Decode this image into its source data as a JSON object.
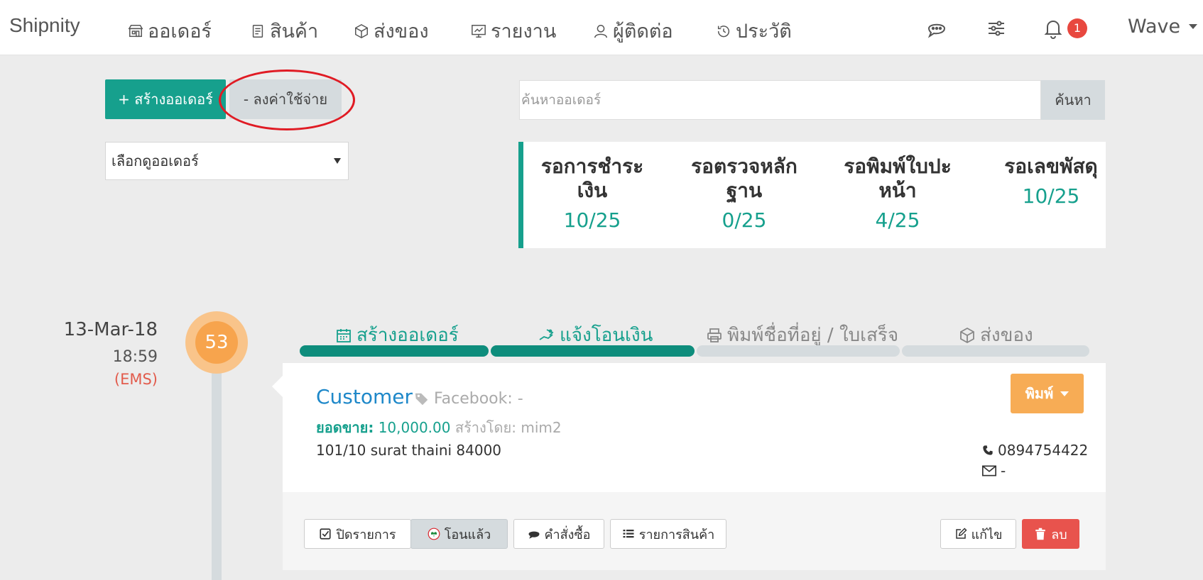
{
  "nav": {
    "brand": "Shipnity",
    "items": [
      {
        "label": "ออเดอร์",
        "icon": "store-icon"
      },
      {
        "label": "สินค้า",
        "icon": "product-icon"
      },
      {
        "label": "ส่งของ",
        "icon": "box-icon"
      },
      {
        "label": "รายงาน",
        "icon": "report-icon"
      },
      {
        "label": "ผู้ติดต่อ",
        "icon": "user-icon"
      },
      {
        "label": "ประวัติ",
        "icon": "history-icon"
      }
    ],
    "notification_count": "1",
    "user_name": "Wave"
  },
  "actions": {
    "create_order": "+ สร้างออเดอร์",
    "record_expense": "- ลงค่าใช้จ่าย",
    "order_filter": "เลือกดูออเดอร์"
  },
  "search": {
    "placeholder": "ค้นหาออเดอร์",
    "button": "ค้นหา"
  },
  "stats": [
    {
      "label_line1": "รอการชำระ",
      "label_line2": "เงิน",
      "value": "10/25"
    },
    {
      "label_line1": "รอตรวจหลัก",
      "label_line2": "ฐาน",
      "value": "0/25"
    },
    {
      "label_line1": "รอพิมพ์ใบปะ",
      "label_line2": "หน้า",
      "value": "4/25"
    },
    {
      "label_line1": "รอเลขพัสดุ",
      "label_line2": "",
      "value": "10/25"
    }
  ],
  "order": {
    "date": "13-Mar-18",
    "time": "18:59",
    "shipping": "(EMS)",
    "number": "53",
    "steps": [
      {
        "label": "สร้างออเดอร์",
        "done": true
      },
      {
        "label": "แจ้งโอนเงิน",
        "done": true
      },
      {
        "label": "พิมพ์ชื่อที่อยู่ / ใบเสร็จ",
        "done": false
      },
      {
        "label": "ส่งของ",
        "done": false
      }
    ],
    "customer": "Customer",
    "facebook": "Facebook: -",
    "sales_label": "ยอดขาย:",
    "sales_value": "10,000.00",
    "created_by": "สร้างโดย: mim2",
    "address": "101/10 surat thaini 84000",
    "phone": "0894754422",
    "email": "-",
    "print_button": "พิมพ์",
    "buttons": {
      "close": "ปิดรายการ",
      "transferred": "โอนแล้ว",
      "order_request": "คำสั่งซื้อ",
      "product_list": "รายการสินค้า",
      "edit": "แก้ไข",
      "delete": "ลบ"
    }
  },
  "colors": {
    "primary": "#16a08d",
    "accent": "#f7ac55",
    "danger": "#e8534d",
    "link": "#1e88c9"
  }
}
